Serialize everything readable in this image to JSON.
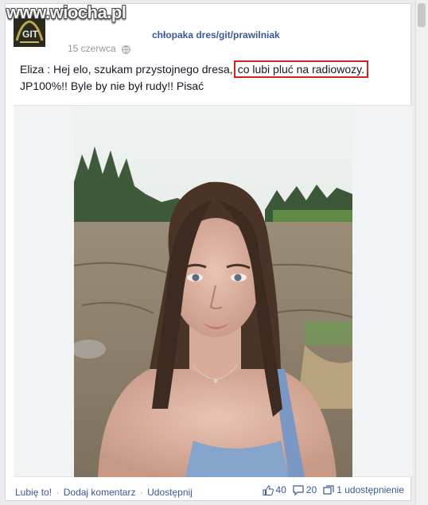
{
  "watermark": "www.wiocha.pl",
  "post": {
    "page_name": "chłopaka dres/git/prawilniak",
    "date": "15 czerwca",
    "text_before": "Eliza : Hej elo, szukam przystojnego dresa,",
    "text_highlight": "co lubi pluć na radiowozy.",
    "text_after": "JP100%!! Byle by nie był rudy!! Pisać"
  },
  "footer": {
    "like": "Lubię to!",
    "comment": "Dodaj komentarz",
    "share": "Udostępnij",
    "separator": "·",
    "likes_count": "40",
    "comments_count": "20",
    "shares_text": "1 udostępnienie"
  },
  "colors": {
    "link": "#3b5998",
    "highlight_border": "#d42020",
    "muted": "#9197a3"
  },
  "icons": {
    "privacy": "globe-icon",
    "likes": "thumbs-up-icon",
    "comments": "comment-bubble-icon",
    "shares": "share-icon"
  }
}
